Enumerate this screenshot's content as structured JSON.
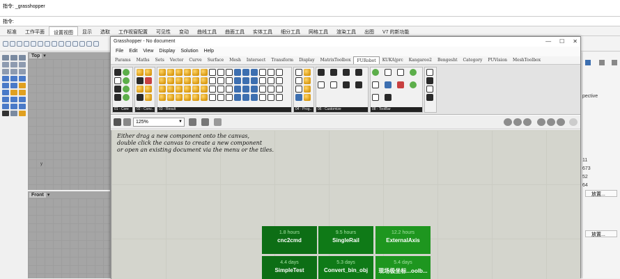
{
  "rhino": {
    "command_history": "指令: _grasshopper",
    "command_prompt": "指令:",
    "tabs": [
      "标准",
      "工作平面",
      "设置视图",
      "显示",
      "选取",
      "工作视窗配置",
      "可见性",
      "变动",
      "曲线工具",
      "曲面工具",
      "实体工具",
      "细分工具",
      "网格工具",
      "渲染工具",
      "出图",
      "V7 的新功能"
    ],
    "active_tab_index": 2,
    "viewports": {
      "top": "Top",
      "front": "Front",
      "axis_y": "y"
    },
    "right_panel": {
      "text": [
        "pective",
        "11",
        "673",
        "52",
        "64"
      ],
      "button": "放置..."
    }
  },
  "grasshopper": {
    "title": "Grasshopper - No document",
    "controls": {
      "minimize": "—",
      "maximize": "☐",
      "close": "✕"
    },
    "menu": [
      "File",
      "Edit",
      "View",
      "Display",
      "Solution",
      "Help"
    ],
    "ribbon_tabs": [
      "Params",
      "Maths",
      "Sets",
      "Vector",
      "Curve",
      "Surface",
      "Mesh",
      "Intersect",
      "Transform",
      "Display",
      "MatrixToolbox",
      "FURobot",
      "KUKA|prc",
      "Kangaroo2",
      "Bengesht",
      "Category",
      "PUVision",
      "MeshToolbox"
    ],
    "active_ribbon_tab": 11,
    "ribbon_groups": [
      "01 - Core",
      "02 - Conv..",
      "03 - Result",
      "04 - Prog..",
      "06 - Customize",
      "08 - ToolBar"
    ],
    "zoom": "125%",
    "canvas_hints": [
      "Either drag a new component onto the canvas,",
      "double click the canvas to create a new component",
      "or open an existing document via the menu or the tiles."
    ],
    "tiles": [
      {
        "time": "1.8 hours",
        "name": "cnc2cmd"
      },
      {
        "time": "9.5 hours",
        "name": "SingleRail"
      },
      {
        "time": "12.2 hours",
        "name": "ExternalAxis"
      },
      {
        "time": "4.4 days",
        "name": "SimpleTest"
      },
      {
        "time": "5.3 days",
        "name": "Convert_bin_obj"
      },
      {
        "time": "5.4 days",
        "name": "现场极坐标...oolb..."
      }
    ]
  }
}
